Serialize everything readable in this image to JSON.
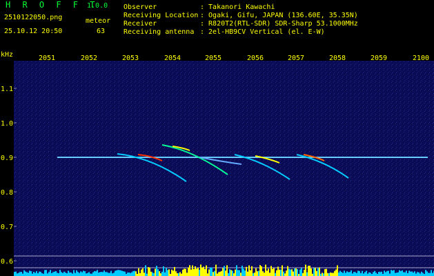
{
  "app": {
    "logo": "H R O F F T",
    "version": "1.0.0",
    "filename": "2510122050.png",
    "datetime": "25.10.12 20:50",
    "event_type": "meteor",
    "event_count": "63"
  },
  "info": [
    {
      "label": "Observer",
      "value": ": Takanori Kawachi"
    },
    {
      "label": "Receiving Location",
      "value": ": Ogaki, Gifu, JAPAN (136.60E, 35.35N)"
    },
    {
      "label": "Receiver",
      "value": ": R820T2(RTL-SDR) SDR-Sharp 53.1000MHz"
    },
    {
      "label": "Receiving antenna",
      "value": ": 2el-HB9CV Vertical (el. E-W)"
    }
  ],
  "axes": {
    "y_unit": "kHz",
    "y_ticks": [
      "1.1",
      "1.0",
      "0.9",
      "0.8",
      "0.7",
      "0.6"
    ],
    "x_ticks": [
      "2051",
      "2052",
      "2053",
      "2054",
      "2055",
      "2056",
      "2057",
      "2058",
      "2059",
      "2100"
    ]
  },
  "colors": {
    "background": "#000000",
    "text": "#ffff00",
    "logo": "#00ff33",
    "spectrogram_bg": "#0a0a55",
    "carrier": "#66ccff",
    "echo_hot": "#ff3300",
    "echo_warm": "#ffff00",
    "echo_cool": "#00ff99",
    "level_yellow": "#ffff00",
    "level_cyan": "#00ccff"
  }
}
